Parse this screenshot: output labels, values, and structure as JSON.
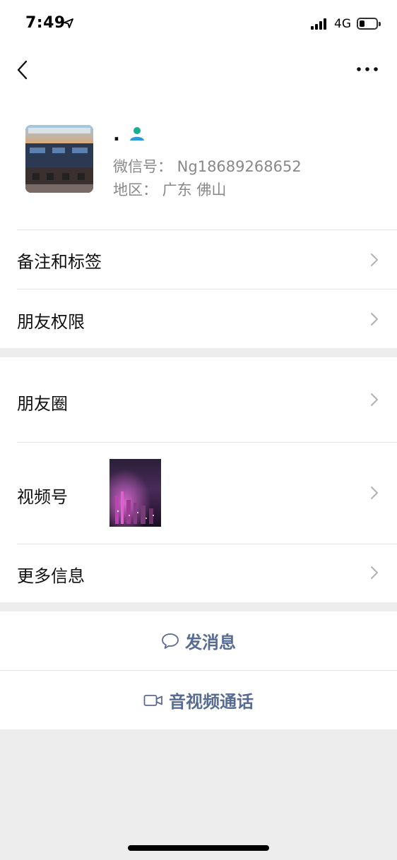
{
  "status_bar": {
    "time": "7:49",
    "network": "4G",
    "battery_level": 0.25
  },
  "nav": {
    "back_icon": "chevron-left-icon",
    "more_icon": "ellipsis-icon"
  },
  "profile": {
    "name": ".",
    "wechat_id": "微信号： Ng18689268652",
    "region": "地区： 广东 佛山",
    "contact_icon": "person-icon",
    "accent_color": "#1aad8f"
  },
  "rows": {
    "remarks_tags": "备注和标签",
    "friend_permissions": "朋友权限",
    "moments": "朋友圈",
    "channels": "视频号",
    "more_info": "更多信息"
  },
  "actions": {
    "send_message": "发消息",
    "video_call": "音视频通话",
    "link_color": "#576b95"
  }
}
